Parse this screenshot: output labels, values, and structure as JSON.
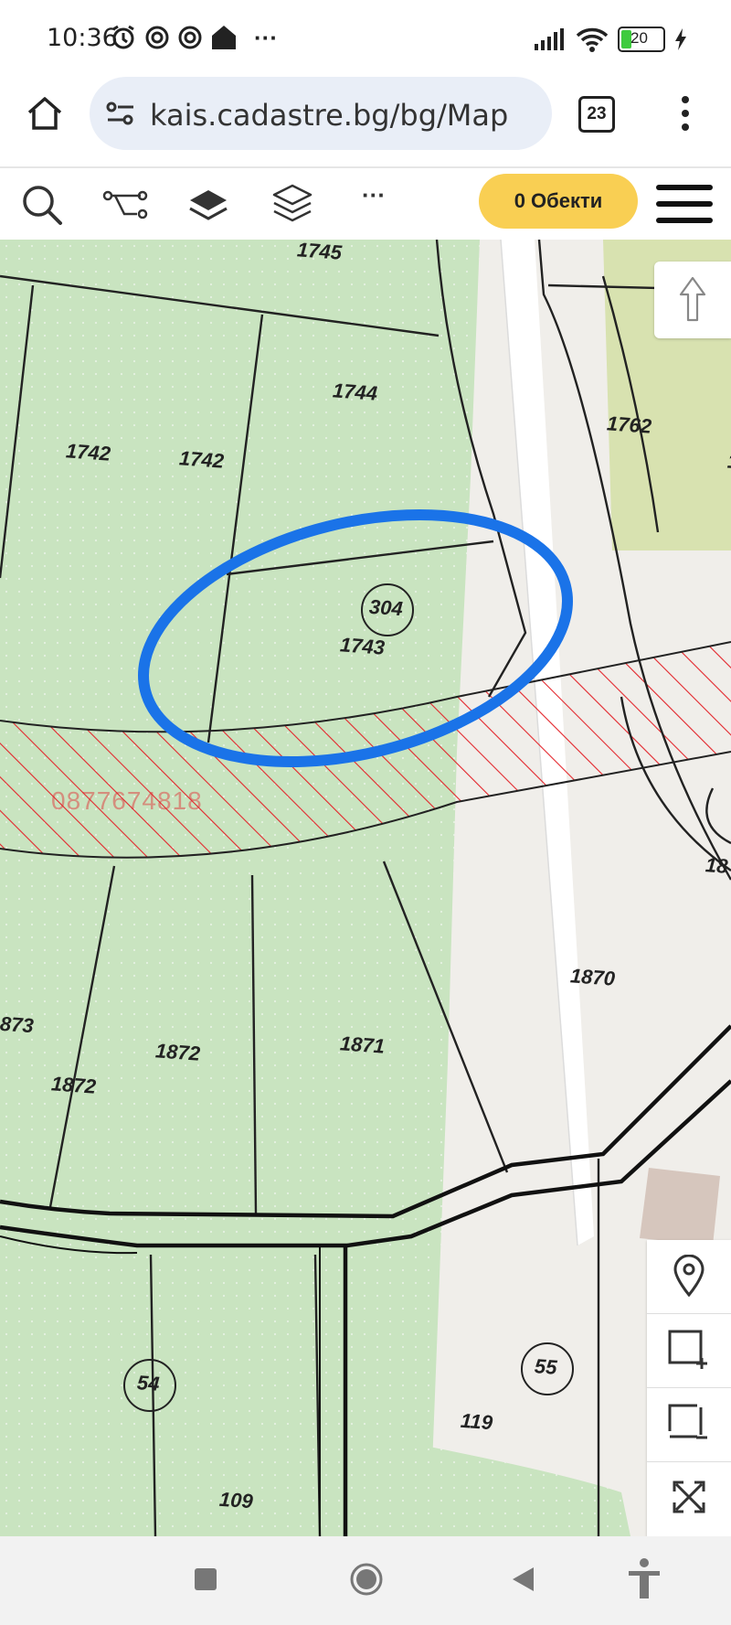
{
  "status_bar": {
    "time": "10:36",
    "battery": "20",
    "overflow": "···"
  },
  "browser": {
    "url": "kais.cadastre.bg/bg/Map",
    "tab_count": "23"
  },
  "toolbar": {
    "overflow": "···",
    "objects_button": "0 Обекти"
  },
  "map": {
    "parcel_labels": [
      "1745",
      "1744",
      "1742",
      "1742",
      "1743",
      "1762",
      "1870",
      "1871",
      "1872",
      "1872",
      "873",
      "119",
      "109",
      "18",
      "1"
    ],
    "circled_labels": [
      "304",
      "54",
      "55"
    ],
    "watermark": "0877674818"
  },
  "colors": {
    "parcel_green": "#c9e4c0",
    "road_grey": "#f0eeea",
    "hatch_red": "#e3262c",
    "highlight_blue": "#1a73e8",
    "accent_yellow": "#f9cf53"
  }
}
